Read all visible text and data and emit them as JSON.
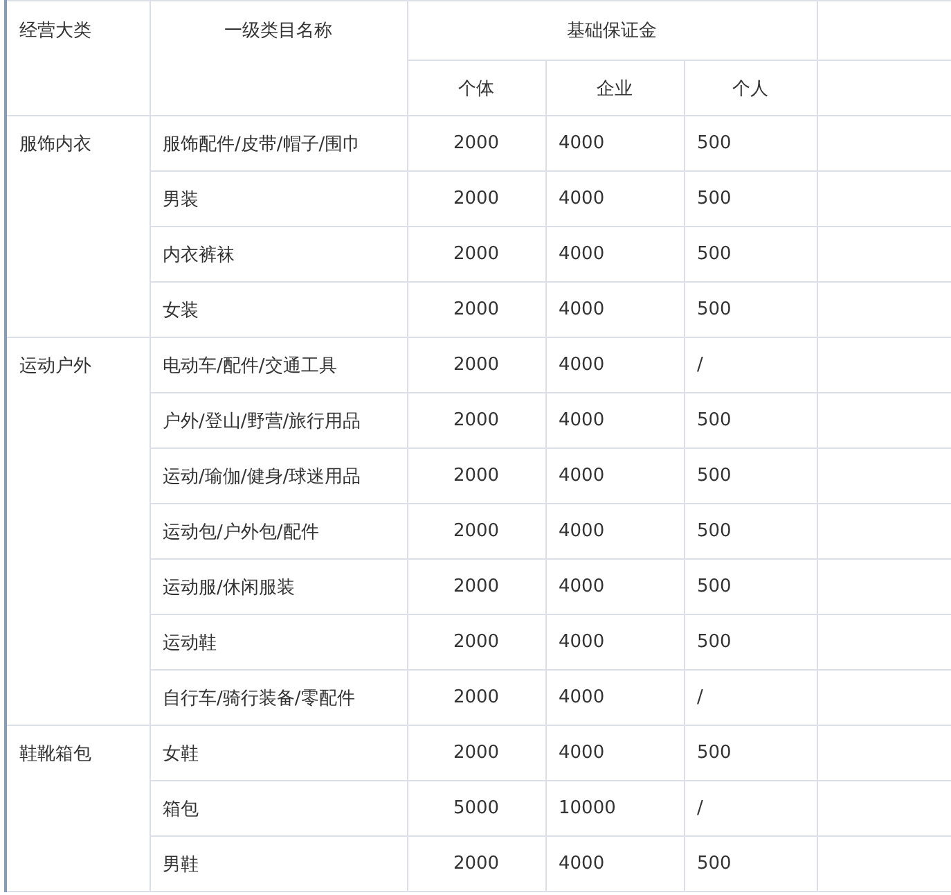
{
  "table": {
    "columns": {
      "category": "经营大类",
      "subcategory": "一级类目名称",
      "deposit": "基础保证金",
      "deposit_types": [
        "个体",
        "企业",
        "个人"
      ]
    },
    "groups": [
      {
        "name": "服饰内衣",
        "rows": [
          {
            "name": "服饰配件/皮带/帽子/围巾",
            "values": [
              "2000",
              "4000",
              "500"
            ]
          },
          {
            "name": "男装",
            "values": [
              "2000",
              "4000",
              "500"
            ]
          },
          {
            "name": "内衣裤袜",
            "values": [
              "2000",
              "4000",
              "500"
            ]
          },
          {
            "name": "女装",
            "values": [
              "2000",
              "4000",
              "500"
            ]
          }
        ]
      },
      {
        "name": "运动户外",
        "rows": [
          {
            "name": "电动车/配件/交通工具",
            "values": [
              "2000",
              "4000",
              "/"
            ]
          },
          {
            "name": "户外/登山/野营/旅行用品",
            "values": [
              "2000",
              "4000",
              "500"
            ]
          },
          {
            "name": "运动/瑜伽/健身/球迷用品",
            "values": [
              "2000",
              "4000",
              "500"
            ]
          },
          {
            "name": "运动包/户外包/配件",
            "values": [
              "2000",
              "4000",
              "500"
            ]
          },
          {
            "name": "运动服/休闲服装",
            "values": [
              "2000",
              "4000",
              "500"
            ]
          },
          {
            "name": "运动鞋",
            "values": [
              "2000",
              "4000",
              "500"
            ]
          },
          {
            "name": "自行车/骑行装备/零配件",
            "values": [
              "2000",
              "4000",
              "/"
            ]
          }
        ]
      },
      {
        "name": "鞋靴箱包",
        "rows": [
          {
            "name": "女鞋",
            "values": [
              "2000",
              "4000",
              "500"
            ]
          },
          {
            "name": "箱包",
            "values": [
              "5000",
              "10000",
              "/"
            ]
          },
          {
            "name": "男鞋",
            "values": [
              "2000",
              "4000",
              "500"
            ]
          }
        ]
      }
    ]
  }
}
